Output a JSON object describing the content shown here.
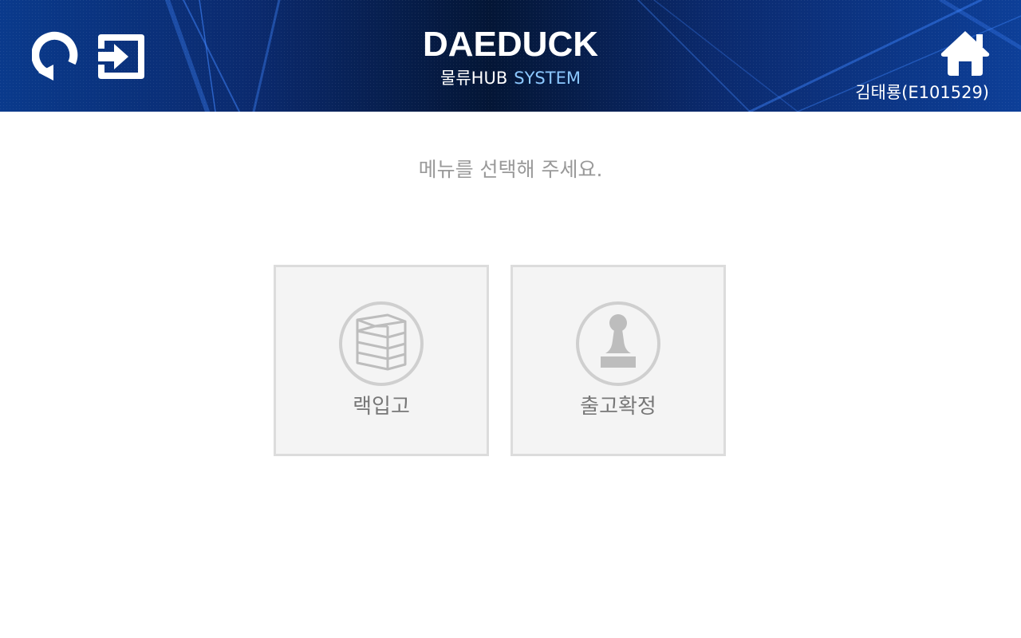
{
  "header": {
    "brand_title": "DAEDUCK",
    "brand_sub_hub": "물류HUB",
    "brand_sub_system": "SYSTEM",
    "user": "김태룡(E101529)",
    "icons": {
      "refresh": "refresh-icon",
      "logout": "logout-icon",
      "home": "home-icon"
    },
    "colors": {
      "background": "#0b2a6e",
      "accent": "#8cc8ff"
    }
  },
  "main": {
    "instruction": "메뉴를 선택해 주세요.",
    "menu": [
      {
        "label": "랙입고",
        "icon": "rack-icon"
      },
      {
        "label": "출고확정",
        "icon": "stamp-icon"
      }
    ]
  }
}
